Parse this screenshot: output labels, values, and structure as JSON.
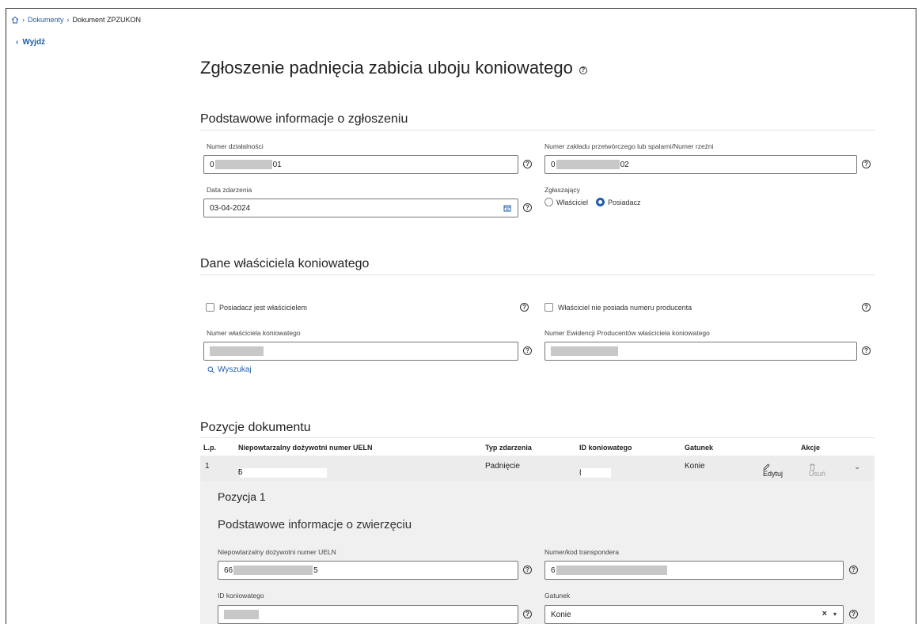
{
  "breadcrumb": {
    "items": [
      "Dokumenty",
      "Dokument ZPZUKON"
    ]
  },
  "back_label": "Wyjdź",
  "page_title": "Zgłoszenie padnięcia zabicia uboju koniowatego",
  "help_glyph": "?",
  "section_basic": {
    "title": "Podstawowe informacje o zgłoszeniu",
    "activity_number": {
      "label": "Numer działalności",
      "value_start": "0",
      "value_end": "01"
    },
    "plant_number": {
      "label": "Numer zakładu przetwórczego lub spalarni/Numer rzeźni",
      "value_start": "0",
      "value_end": "02"
    },
    "event_date": {
      "label": "Data zdarzenia",
      "value": "03-04-2024"
    },
    "reporter": {
      "label": "Zgłaszający",
      "options": [
        "Właściciel",
        "Posiadacz"
      ],
      "selected": "Posiadacz"
    }
  },
  "section_owner": {
    "title": "Dane właściciela koniowatego",
    "holder_is_owner": {
      "label": "Posiadacz jest właścicielem",
      "checked": false
    },
    "owner_no_producer_number": {
      "label": "Właściciel nie posiada numeru producenta",
      "checked": false
    },
    "owner_number": {
      "label": "Numer właściciela koniowatego"
    },
    "producer_registry_number": {
      "label": "Numer Ewidencji Producentów właściciela koniowatego"
    },
    "search_label": "Wyszukaj"
  },
  "section_items": {
    "title": "Pozycje dokumentu",
    "columns": [
      "L.p.",
      "Niepowtarzalny dożywotni numer UELN",
      "Typ zdarzenia",
      "ID koniowatego",
      "Gatunek",
      "Akcje"
    ],
    "rows": [
      {
        "lp": "1",
        "ueln_start": "6",
        "ueln_end": "5",
        "event_type": "Padnięcie",
        "id_start": "(",
        "species": "Konie"
      }
    ],
    "edit_label": "Edytuj",
    "delete_label": "Usuń"
  },
  "detail": {
    "title": "Pozycja 1",
    "subtitle": "Podstawowe informacje o zwierzęciu",
    "ueln": {
      "label": "Niepowtarzalny dożywotni numer UELN",
      "value_start": "66",
      "value_end": "5"
    },
    "transponder": {
      "label": "Numer/kod transpondera",
      "value_start": "6"
    },
    "equine_id": {
      "label": "ID koniowatego"
    },
    "species": {
      "label": "Gatunek",
      "value": "Konie"
    }
  },
  "colors": {
    "accent": "#1f5ea8",
    "row_bg": "#ececec",
    "detail_bg": "#f0f0f0",
    "mask": "#c8c8c8"
  }
}
